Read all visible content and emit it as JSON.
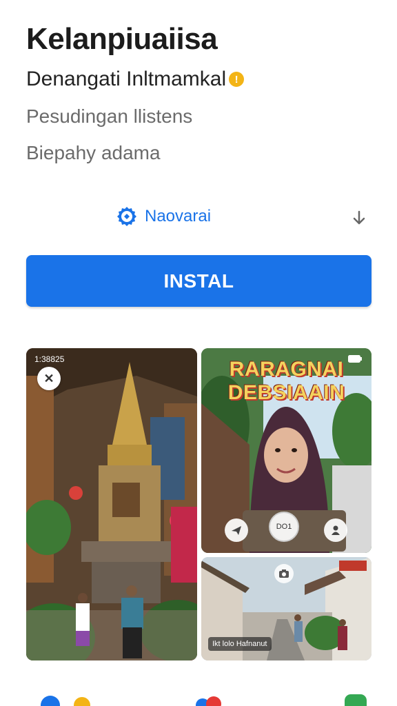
{
  "app": {
    "title": "Kelanpiuaiisa",
    "subtitle": "Denangati Inltmamkal",
    "subtitle_badge": "!",
    "meta_line_1": "Pesudingan  llistens",
    "meta_line_2": "Biepahy adama",
    "developer": "Naovarai",
    "install_label": "INSTAL"
  },
  "screenshots": {
    "left": {
      "time": "1:38825",
      "close_glyph": "✕"
    },
    "right_top": {
      "promo_line_1": "RARAGNAI",
      "promo_line_2": "DEBSIAAIN",
      "control_mid": "DO1"
    },
    "right_bottom": {
      "caption": "Ikt lolo Hafnanut"
    }
  },
  "colors": {
    "accent": "#1a73e8",
    "warning": "#f3b416",
    "text_primary": "#1c1c1c",
    "text_secondary": "#6b6b6b"
  },
  "icons": {
    "developer": "gear-badge-icon",
    "expand": "arrow-down-icon",
    "close": "close-icon",
    "battery": "battery-icon",
    "camera": "camera-icon"
  }
}
